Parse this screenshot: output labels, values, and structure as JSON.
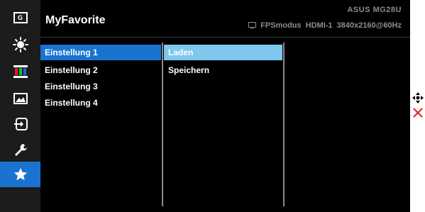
{
  "header": {
    "title": "MyFavorite",
    "model": "ASUS  MG28U",
    "mode": "FPSmodus",
    "input": "HDMI-1",
    "resolution": "3840x2160@60Hz"
  },
  "sidebar": {
    "items": [
      {
        "icon": "game-icon",
        "label": "G"
      },
      {
        "icon": "brightness-icon"
      },
      {
        "icon": "color-icon"
      },
      {
        "icon": "image-icon"
      },
      {
        "icon": "input-select-icon"
      },
      {
        "icon": "system-setup-icon"
      },
      {
        "icon": "star-icon",
        "active": true
      }
    ]
  },
  "menu": {
    "left": [
      "Einstellung 1",
      "Einstellung 2",
      "Einstellung 3",
      "Einstellung 4"
    ],
    "middle": [
      "Laden",
      "Speichern"
    ]
  },
  "controls": {
    "items": [
      "navigate-icon",
      "close-icon"
    ]
  },
  "colors": {
    "accent": "#1a73d0",
    "highlight": "#7ec8f0",
    "close": "#e02020"
  }
}
